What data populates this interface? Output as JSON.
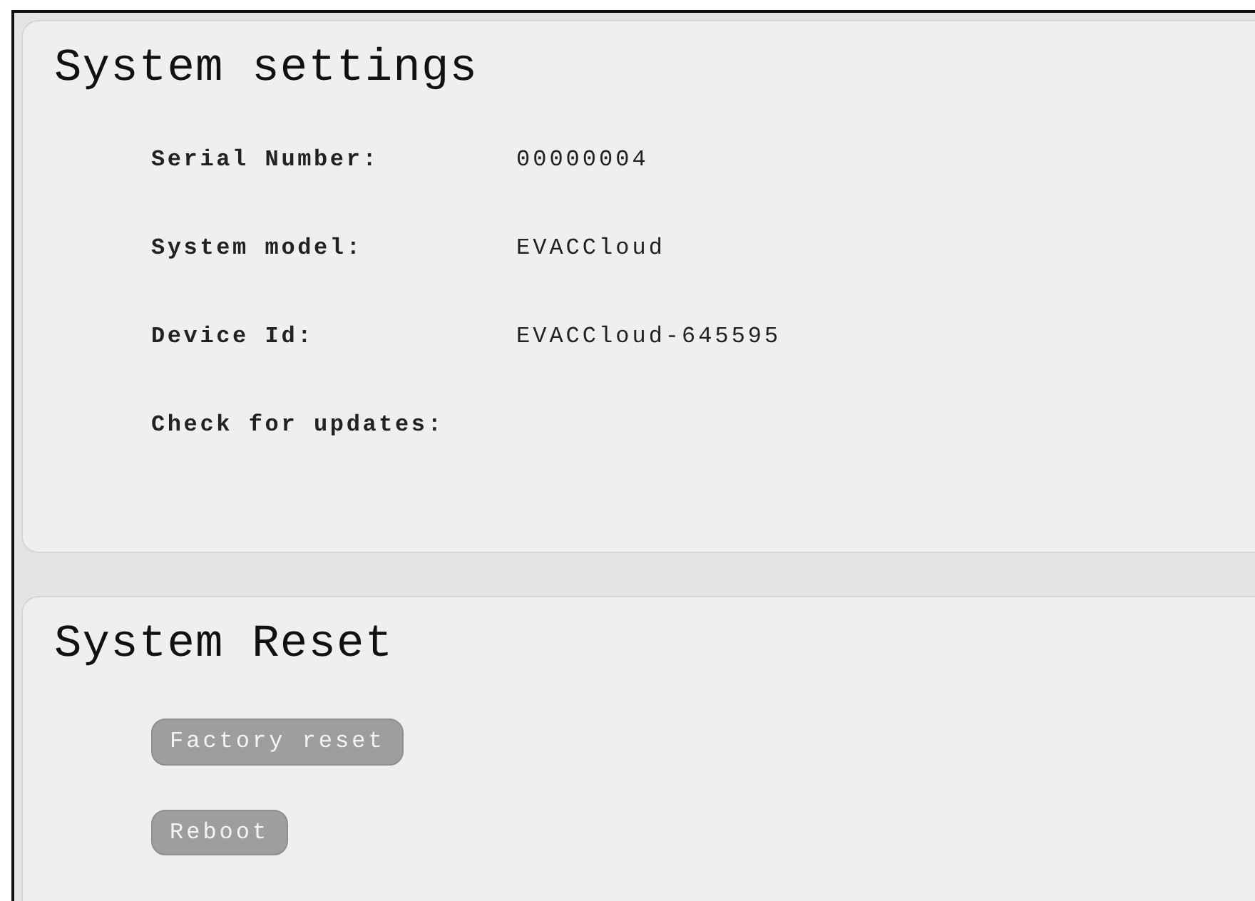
{
  "sections": [
    {
      "title": "System settings",
      "fields": [
        {
          "label": "Serial Number:",
          "value": "00000004"
        },
        {
          "label": "System model:",
          "value": "EVACCloud"
        },
        {
          "label": "Device Id:",
          "value": "EVACCloud-645595"
        },
        {
          "label": "Check for updates:"
        }
      ]
    },
    {
      "title": "System Reset",
      "buttons": [
        {
          "label": "Factory reset"
        },
        {
          "label": "Reboot"
        }
      ]
    }
  ]
}
